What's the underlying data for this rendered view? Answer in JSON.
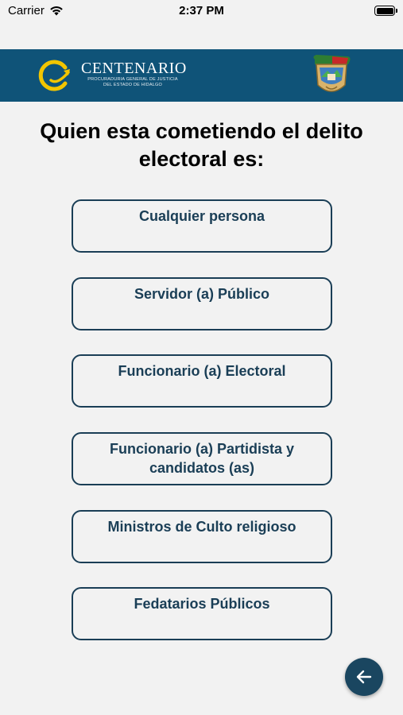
{
  "status_bar": {
    "carrier": "Carrier",
    "time": "2:37 PM"
  },
  "header": {
    "logo_title": "CENTENARIO",
    "logo_subtitle_line1": "PROCURADURIA GENERAL DE JUSTICIA",
    "logo_subtitle_line2": "DEL ESTADO DE HIDALGO",
    "brand_color": "#0f5378",
    "logo_accent": "#f2c500",
    "icons": [
      "centenario-logo-icon",
      "hidalgo-seal-icon"
    ]
  },
  "question": {
    "text": "Quien esta cometiendo el delito electoral es:"
  },
  "options": [
    {
      "label": "Cualquier persona"
    },
    {
      "label": "Servidor (a) Público"
    },
    {
      "label": "Funcionario (a) Electoral"
    },
    {
      "label": "Funcionario (a) Partidista y candidatos (as)"
    },
    {
      "label": "Ministros de Culto religioso"
    },
    {
      "label": "Fedatarios Públicos"
    }
  ],
  "back_button": {
    "icon": "arrow-left-icon",
    "color": "#1a4660"
  }
}
